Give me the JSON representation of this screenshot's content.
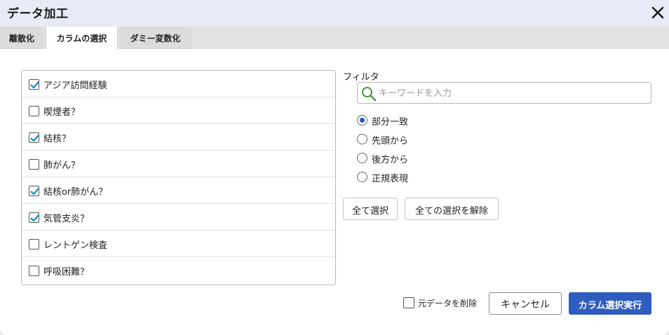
{
  "dialog": {
    "title": "データ加工",
    "close_icon": "close-icon"
  },
  "tabs": [
    {
      "label": "離散化",
      "active": false
    },
    {
      "label": "カラムの選択",
      "active": true
    },
    {
      "label": "ダミー変数化",
      "active": false
    }
  ],
  "columns": [
    {
      "label": "アジア訪問経験",
      "checked": true
    },
    {
      "label": "喫煙者？",
      "checked": false
    },
    {
      "label": "結核？",
      "checked": true
    },
    {
      "label": "肺がん？",
      "checked": false
    },
    {
      "label": "結核or肺がん？",
      "checked": true
    },
    {
      "label": "気管支炎？",
      "checked": true
    },
    {
      "label": "レントゲン検査",
      "checked": false
    },
    {
      "label": "呼吸困難？",
      "checked": false
    }
  ],
  "filter": {
    "label": "フィルタ",
    "value": "",
    "placeholder": "キーワードを入力",
    "icon": "search-icon"
  },
  "match_modes": [
    {
      "label": "部分一致",
      "selected": true
    },
    {
      "label": "先頭から",
      "selected": false
    },
    {
      "label": "後方から",
      "selected": false
    },
    {
      "label": "正規表現",
      "selected": false
    }
  ],
  "buttons": {
    "select_all": "全て選択",
    "clear_all": "全ての選択を解除",
    "cancel": "キャンセル",
    "run": "カラム選択実行"
  },
  "delete_original": {
    "label": "元データを削除",
    "checked": false
  },
  "colors": {
    "accent": "#2f5dbf",
    "check": "#1a8ab8",
    "radio": "#1a56b8",
    "search_icon": "#3a9a3a",
    "titlebar": "#e8ebf5"
  }
}
